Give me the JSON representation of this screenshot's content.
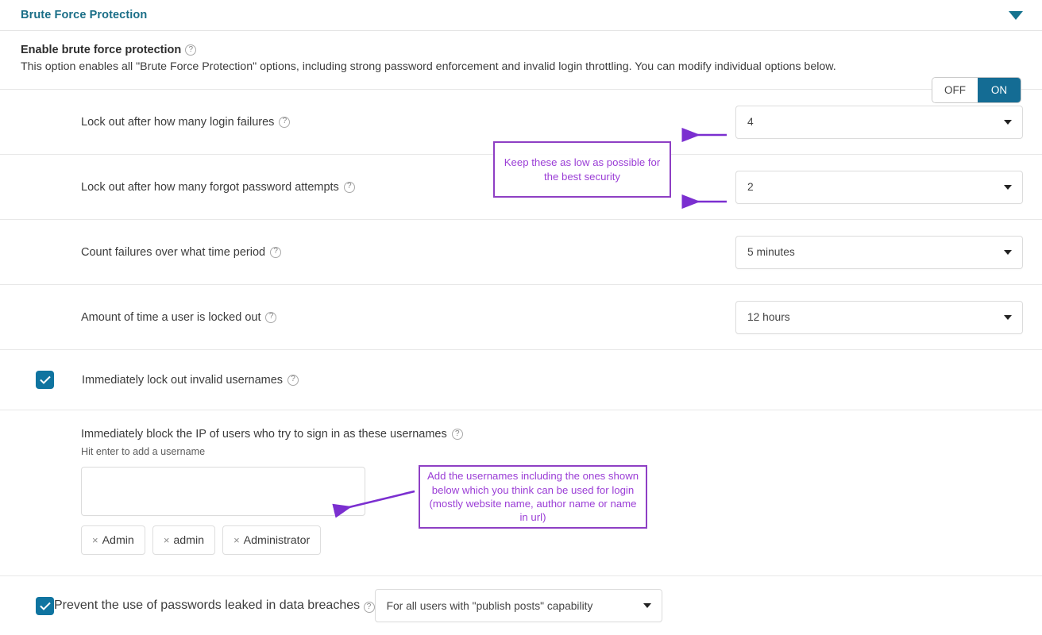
{
  "panel": {
    "title": "Brute Force Protection",
    "collapse_icon": "chevron-down-icon"
  },
  "enable": {
    "title": "Enable brute force protection",
    "help_icon": "?",
    "description": "This option enables all \"Brute Force Protection\" options, including strong password enforcement and invalid login throttling. You can modify individual options below.",
    "toggle": {
      "off_label": "OFF",
      "on_label": "ON",
      "value": "ON"
    }
  },
  "settings": [
    {
      "label": "Lock out after how many login failures",
      "value": "4"
    },
    {
      "label": "Lock out after how many forgot password attempts",
      "value": "2"
    },
    {
      "label": "Count failures over what time period",
      "value": "5 minutes"
    },
    {
      "label": "Amount of time a user is locked out",
      "value": "12 hours"
    }
  ],
  "invalid_usernames_checkbox": {
    "label": "Immediately lock out invalid usernames",
    "checked": true
  },
  "usernames": {
    "title": "Immediately block the IP of users who try to sign in as these usernames",
    "hint": "Hit enter to add a username",
    "input_value": "",
    "input_placeholder": "",
    "tags": [
      "Admin",
      "admin",
      "Administrator"
    ],
    "remove_glyph": "×"
  },
  "leaked_passwords": {
    "label": "Prevent the use of passwords leaked in data breaches",
    "checked": true,
    "value": "For all users with \"publish posts\" capability"
  },
  "annotations": [
    {
      "text": "Keep these as low as possible for the best security"
    },
    {
      "text": "Add the usernames including the ones shown below which you think can be used for login (mostly website name, author name or name in url)"
    }
  ],
  "colors": {
    "panel_title": "#1a6e87",
    "accent": "#0f74a0",
    "toggle_on": "#146c94",
    "annotation": "#9b3ed6"
  }
}
